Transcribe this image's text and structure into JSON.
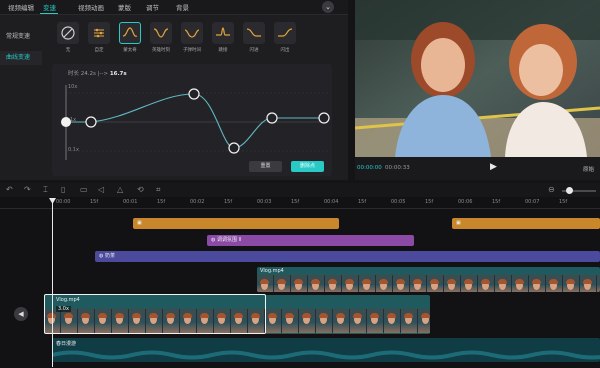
{
  "tabs": [
    {
      "label": "视频编辑",
      "active": false
    },
    {
      "label": "变速",
      "active": true
    },
    {
      "label": "视频动画",
      "active": false
    },
    {
      "label": "蒙版",
      "active": false
    },
    {
      "label": "调节",
      "active": false
    },
    {
      "label": "背景",
      "active": false
    }
  ],
  "collapse_icon": "chevron-down-icon",
  "sidebar": [
    {
      "label": "常规变速",
      "active": false
    },
    {
      "label": "曲线变速",
      "active": true
    }
  ],
  "presets": [
    {
      "label": "无",
      "icon": "none-icon",
      "active": false
    },
    {
      "label": "自定",
      "icon": "custom-curve-icon",
      "active": false
    },
    {
      "label": "蒙太奇",
      "icon": "montage-curve-icon",
      "active": true
    },
    {
      "label": "英雄时刻",
      "icon": "hero-moment-curve-icon",
      "active": false
    },
    {
      "label": "子弹时间",
      "icon": "bullet-time-curve-icon",
      "active": false
    },
    {
      "label": "跳接",
      "icon": "jump-cut-curve-icon",
      "active": false
    },
    {
      "label": "闪进",
      "icon": "flash-in-curve-icon",
      "active": false
    },
    {
      "label": "闪出",
      "icon": "flash-out-curve-icon",
      "active": false
    }
  ],
  "curve_editor": {
    "duration_prefix": "时长 24.2s",
    "duration_arrow": "|-->",
    "duration_new": "16.7s",
    "y_labels": [
      "10x",
      "1x",
      "0.1x"
    ],
    "reset_label": "重置",
    "delete_point_label": "删除点",
    "accent": "#29c9c6"
  },
  "player": {
    "current_time": "00:00:00",
    "total_time": "00:00:33",
    "play_icon": "play-icon",
    "ratio_label": "原始"
  },
  "toolbar_icons": [
    "undo-icon",
    "redo-icon",
    "split-icon",
    "delete-icon",
    "freeze-icon",
    "mirror-icon",
    "rotate-icon",
    "crop-icon"
  ],
  "zoom_icons": [
    "zoom-out-icon",
    "zoom-slider-icon"
  ],
  "ruler": [
    "00:00",
    "15f",
    "00:01",
    "15f",
    "00:02",
    "15f",
    "00:03",
    "15f",
    "00:04",
    "15f",
    "00:05",
    "15f",
    "00:06",
    "15f",
    "00:07",
    "15f"
  ],
  "tracks": {
    "sticker_clip_label": "",
    "sticker_clip2_label": "",
    "filter_clip_label": "调调氛围 II",
    "text_clip_label": "奶茶",
    "overlay_clip_label": "Vlog.mp4",
    "main_clip_label": "Vlog.mp4",
    "main_clip_speed": "3.0x",
    "audio_clip_label": "春日漫游",
    "mute_icon": "volume-icon",
    "colors": {
      "sticker": "#c9872c",
      "filter": "#8b4aa6",
      "text": "#4c4a9c",
      "video": "#1e5a5e",
      "audio": "#0f3c45"
    }
  }
}
